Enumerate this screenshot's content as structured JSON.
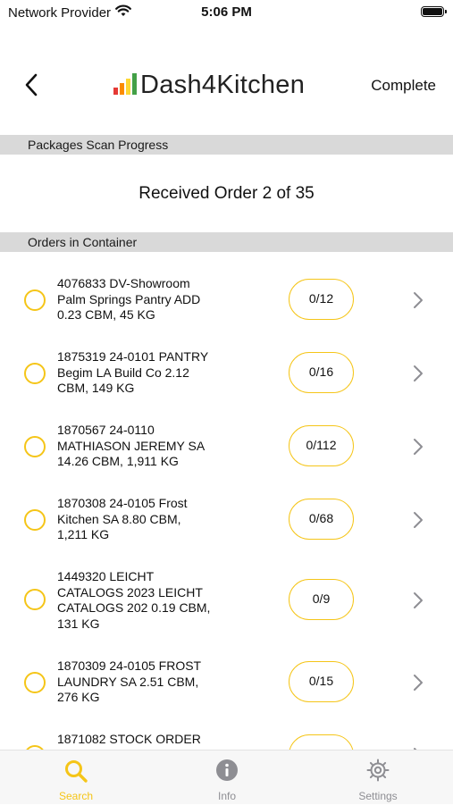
{
  "status_bar": {
    "carrier": "Network Provider",
    "time": "5:06 PM"
  },
  "nav": {
    "title": "Dash4Kitchen",
    "complete_label": "Complete",
    "logo_colors": [
      "#e53935",
      "#fb8c00",
      "#fdd835",
      "#43a047"
    ]
  },
  "sections": {
    "progress_header": "Packages Scan Progress",
    "progress_text": "Received Order 2 of 35",
    "orders_header": "Orders in Container"
  },
  "orders": [
    {
      "lines": [
        "4076833 DV-Showroom",
        "Palm Springs Pantry ADD",
        "0.23 CBM, 45 KG"
      ],
      "count": "0/12"
    },
    {
      "lines": [
        "1875319 24-0101 PANTRY",
        "Begim LA Build Co  2.12",
        "CBM, 149 KG"
      ],
      "count": "0/16"
    },
    {
      "lines": [
        "1870567 24-0110",
        "MATHIASON JEREMY SA",
        "14.26 CBM, 1,911 KG"
      ],
      "count": "0/112"
    },
    {
      "lines": [
        "1870308 24-0105 Frost",
        "Kitchen SA  8.80 CBM,",
        "1,211 KG"
      ],
      "count": "0/68"
    },
    {
      "lines": [
        "1449320 LEICHT",
        "CATALOGS 2023 LEICHT",
        "CATALOGS 202  0.19 CBM,",
        "131 KG"
      ],
      "count": "0/9"
    },
    {
      "lines": [
        "1870309 24-0105 FROST",
        "LAUNDRY SA  2.51 CBM,",
        "276 KG"
      ],
      "count": "0/15"
    },
    {
      "lines": [
        "1871082 STOCK ORDER",
        "",
        ""
      ],
      "count": ""
    }
  ],
  "tabs": [
    {
      "label": "Search",
      "icon": "search-icon",
      "active": true
    },
    {
      "label": "Info",
      "icon": "info-icon",
      "active": false
    },
    {
      "label": "Settings",
      "icon": "gear-icon",
      "active": false
    }
  ],
  "colors": {
    "accent": "#f5c518",
    "inactive_tab": "#8e8e93"
  }
}
